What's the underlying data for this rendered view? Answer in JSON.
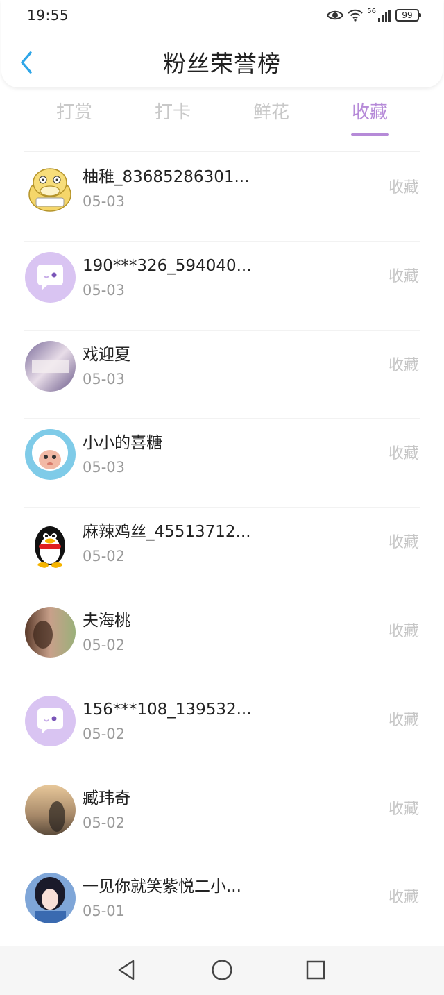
{
  "status_bar": {
    "time": "19:55",
    "network": "56",
    "battery": "99"
  },
  "header": {
    "title": "粉丝荣誉榜",
    "back_icon": "chevron-left-icon"
  },
  "tabs": [
    {
      "label": "打赏",
      "active": false
    },
    {
      "label": "打卡",
      "active": false
    },
    {
      "label": "鲜花",
      "active": false
    },
    {
      "label": "收藏",
      "active": true
    }
  ],
  "colors": {
    "accent": "#b68ad8",
    "back_arrow": "#2fa6e8",
    "default_avatar_bg": "#d9c4f2"
  },
  "fans": [
    {
      "name": "柚稚_83685286301...",
      "date": "05-03",
      "action": "收藏",
      "avatar": "duck-avatar"
    },
    {
      "name": "190***326_594040...",
      "date": "05-03",
      "action": "收藏",
      "avatar": "default-chat-avatar"
    },
    {
      "name": "戏迎夏",
      "date": "05-03",
      "action": "收藏",
      "avatar": "photo-avatar"
    },
    {
      "name": "小小的喜糖",
      "date": "05-03",
      "action": "收藏",
      "avatar": "sheep-avatar"
    },
    {
      "name": "麻辣鸡丝_45513712...",
      "date": "05-02",
      "action": "收藏",
      "avatar": "penguin-avatar"
    },
    {
      "name": "夫海桃",
      "date": "05-02",
      "action": "收藏",
      "avatar": "photo-avatar"
    },
    {
      "name": "156***108_139532...",
      "date": "05-02",
      "action": "收藏",
      "avatar": "default-chat-avatar"
    },
    {
      "name": "臧玮奇",
      "date": "05-02",
      "action": "收藏",
      "avatar": "photo-avatar"
    },
    {
      "name": "一见你就笑紫悦二小...",
      "date": "05-01",
      "action": "收藏",
      "avatar": "anime-avatar"
    }
  ],
  "nav": {
    "back": "triangle-back-icon",
    "home": "circle-home-icon",
    "recents": "square-recents-icon"
  }
}
